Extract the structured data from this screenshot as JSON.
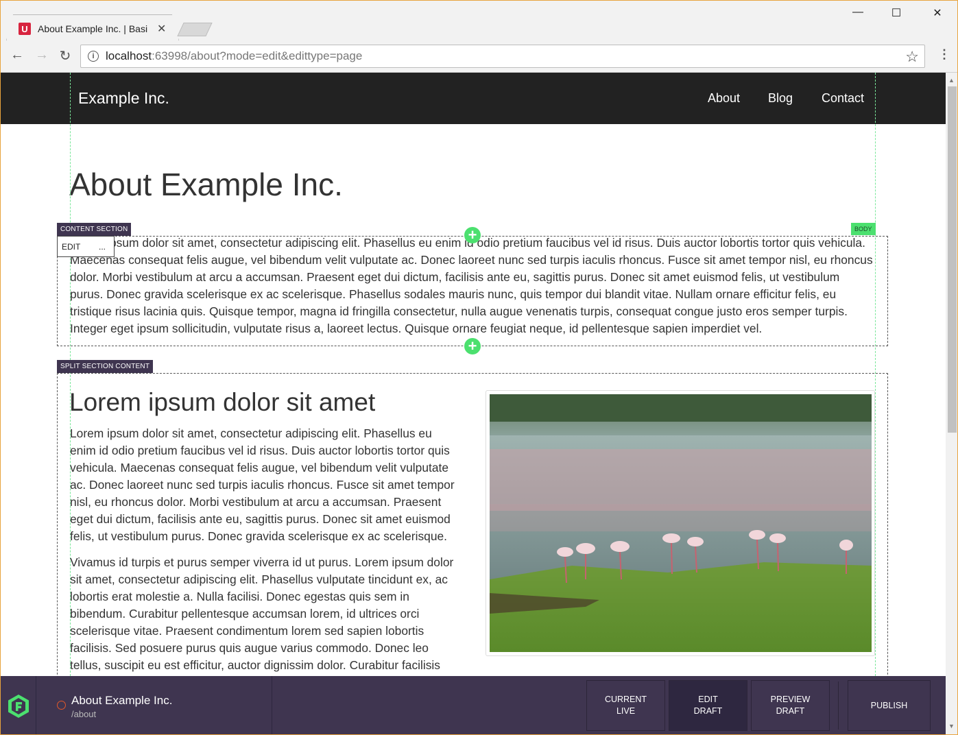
{
  "browser": {
    "tab_title": "About Example Inc. | Basi",
    "favicon_letter": "U",
    "url_host": "localhost",
    "url_rest": ":63998/about?mode=edit&edittype=page",
    "minimize": "—",
    "maximize": "☐",
    "close": "✕"
  },
  "site": {
    "brand": "Example Inc.",
    "nav": [
      "About",
      "Blog",
      "Contact"
    ]
  },
  "page": {
    "title": "About Example Inc.",
    "content_section_label": "CONTENT SECTION",
    "body_label": "BODY",
    "edit_label": "EDIT",
    "more_label": "...",
    "intro_paragraph": "Lorem ipsum dolor sit amet, consectetur adipiscing elit. Phasellus eu enim id odio pretium faucibus vel id risus. Duis auctor lobortis tortor quis vehicula. Maecenas consequat felis augue, vel bibendum velit vulputate ac. Donec laoreet nunc sed turpis iaculis rhoncus. Fusce sit amet tempor nisl, eu rhoncus dolor. Morbi vestibulum at arcu a accumsan. Praesent eget dui dictum, facilisis ante eu, sagittis purus. Donec sit amet euismod felis, ut vestibulum purus. Donec gravida scelerisque ex ac scelerisque. Phasellus sodales mauris nunc, quis tempor dui blandit vitae. Nullam ornare efficitur felis, eu tristique risus lacinia quis. Quisque tempor, magna id fringilla consectetur, nulla augue venenatis turpis, consequat congue justo eros semper turpis. Integer eget ipsum sollicitudin, vulputate risus a, laoreet lectus. Quisque ornare feugiat neque, id pellentesque sapien imperdiet vel.",
    "split_section_label": "SPLIT SECTION CONTENT",
    "split_heading": "Lorem ipsum dolor sit amet",
    "split_paragraph_1": "Lorem ipsum dolor sit amet, consectetur adipiscing elit. Phasellus eu enim id odio pretium faucibus vel id risus. Duis auctor lobortis tortor quis vehicula. Maecenas consequat felis augue, vel bibendum velit vulputate ac. Donec laoreet nunc sed turpis iaculis rhoncus. Fusce sit amet tempor nisl, eu rhoncus dolor. Morbi vestibulum at arcu a accumsan. Praesent eget dui dictum, facilisis ante eu, sagittis purus. Donec sit amet euismod felis, ut vestibulum purus. Donec gravida scelerisque ex ac scelerisque.",
    "split_paragraph_2": "Vivamus id turpis et purus semper viverra id ut purus. Lorem ipsum dolor sit amet, consectetur adipiscing elit. Phasellus vulputate tincidunt ex, ac lobortis erat molestie a. Nulla facilisi. Donec egestas quis sem in bibendum. Curabitur pellentesque accumsan lorem, id ultrices orci scelerisque vitae. Praesent condimentum lorem sed sapien lobortis facilisis. Sed posuere purus quis augue varius commodo. Donec leo tellus, suscipit eu est efficitur, auctor dignissim dolor. Curabitur facilisis"
  },
  "editor_bar": {
    "page_name": "About Example Inc.",
    "page_path": "/about",
    "buttons": [
      "CURRENT\nLIVE",
      "EDIT\nDRAFT",
      "PREVIEW\nDRAFT",
      "PUBLISH"
    ]
  },
  "colors": {
    "editor_bg": "#3f3550",
    "accent_green": "#4ce06f",
    "nav_bg": "#222222"
  }
}
